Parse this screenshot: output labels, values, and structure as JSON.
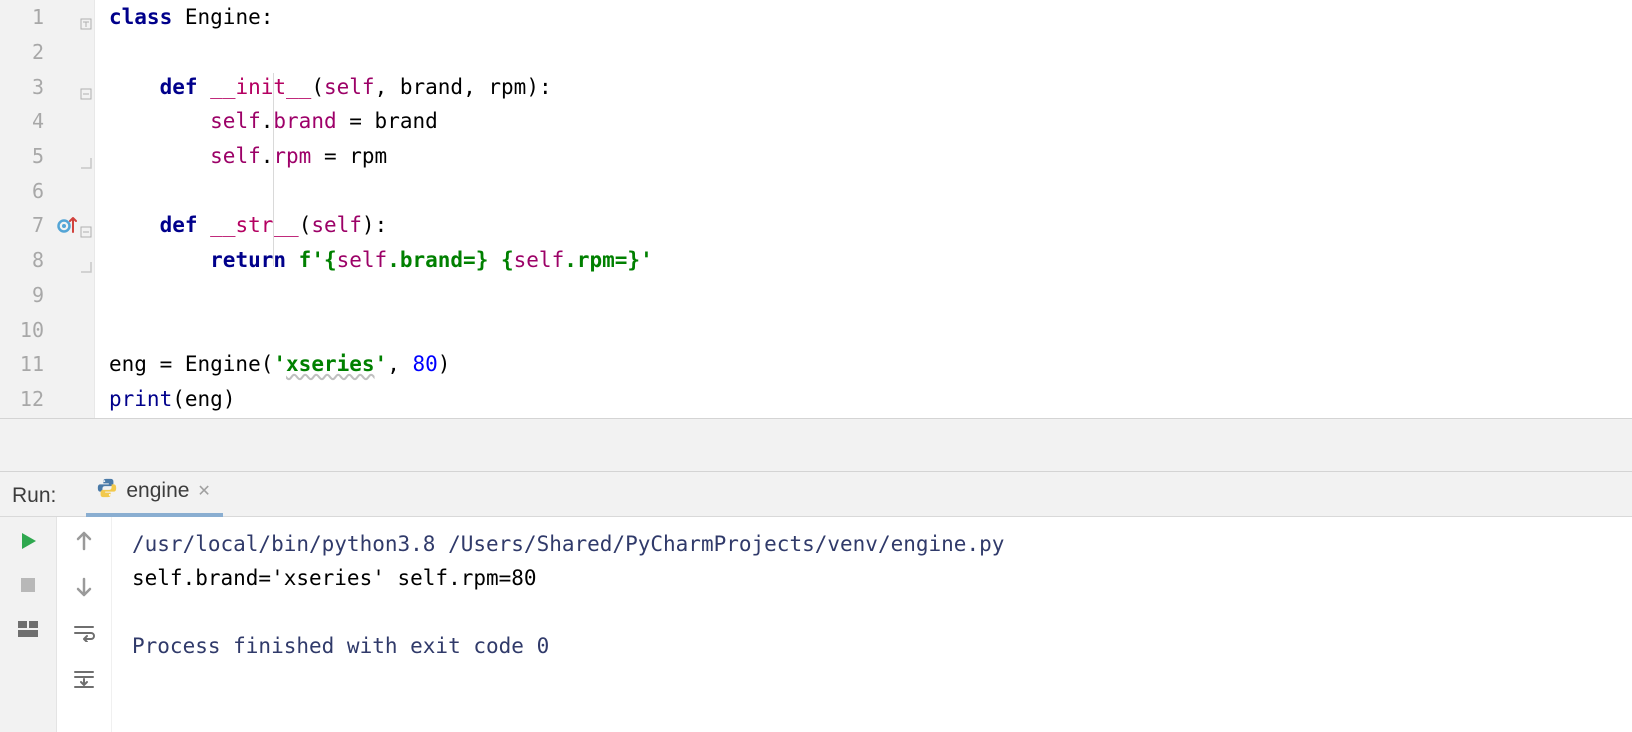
{
  "gutter": {
    "lines": [
      "1",
      "2",
      "3",
      "4",
      "5",
      "6",
      "7",
      "8",
      "9",
      "10",
      "11",
      "12"
    ]
  },
  "code": {
    "l1": {
      "kw": "class",
      "sp": " ",
      "name": "Engine",
      "colon": ":"
    },
    "l3": {
      "ind": "    ",
      "kw": "def",
      "sp": " ",
      "name": "__init__",
      "open": "(",
      "p1": "self",
      "c1": ", ",
      "p2": "brand",
      "c2": ", ",
      "p3": "rpm",
      "close": "):"
    },
    "l4": {
      "ind": "        ",
      "self": "self",
      "dot": ".",
      "attr": "brand ",
      "eq": "= ",
      "rhs": "brand"
    },
    "l5": {
      "ind": "        ",
      "self": "self",
      "dot": ".",
      "attr": "rpm ",
      "eq": "= ",
      "rhs": "rpm"
    },
    "l7": {
      "ind": "    ",
      "kw": "def",
      "sp": " ",
      "name": "__str__",
      "open": "(",
      "p1": "self",
      "close": "):"
    },
    "l8": {
      "ind": "        ",
      "kw": "return",
      "sp": " ",
      "fpre": "f'",
      "s1": "{",
      "self1": "self",
      "s2": ".brand=} {",
      "self2": "self",
      "s3": ".rpm=}",
      "fend": "'"
    },
    "l11": {
      "lhs": "eng = Engine(",
      "str": "'",
      "typo": "xseries",
      "strend": "'",
      "comma": ", ",
      "num": "80",
      "close": ")"
    },
    "l12": {
      "fn": "print",
      "open": "(",
      "arg": "eng",
      "close": ")"
    }
  },
  "run": {
    "panel_title": "Run:",
    "tab_name": "engine",
    "console": {
      "cmd": "/usr/local/bin/python3.8 /Users/Shared/PyCharmProjects/venv/engine.py",
      "out": "self.brand='xseries' self.rpm=80",
      "blank": "",
      "exit": "Process finished with exit code 0"
    }
  }
}
